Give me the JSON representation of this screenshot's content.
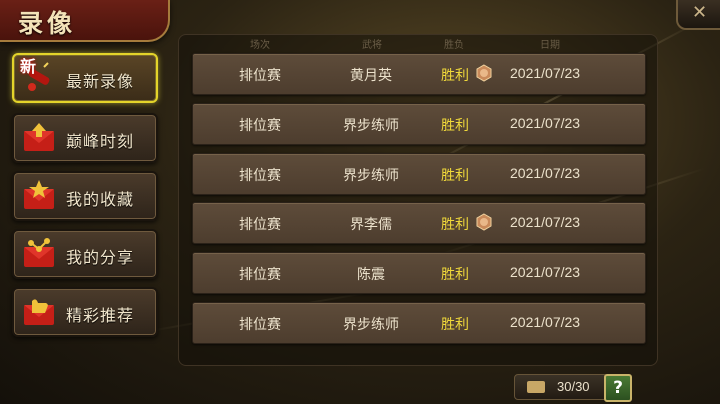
{
  "title": "录像",
  "sidebar": {
    "new_badge": "新",
    "items": [
      {
        "label": "最新录像",
        "icon": "firecracker-icon",
        "active": true
      },
      {
        "label": "巅峰时刻",
        "icon": "red-envelope-up-arrow-icon",
        "active": false
      },
      {
        "label": "我的收藏",
        "icon": "red-envelope-star-icon",
        "active": false
      },
      {
        "label": "我的分享",
        "icon": "red-envelope-share-icon",
        "active": false
      },
      {
        "label": "精彩推荐",
        "icon": "red-envelope-thumbs-up-icon",
        "active": false
      }
    ]
  },
  "table": {
    "headers": [
      "场次",
      "武将",
      "胜负",
      "日期"
    ],
    "rows": [
      {
        "mode": "排位赛",
        "general": "黄月英",
        "result": "胜利",
        "badge": true,
        "date": "2021/07/23"
      },
      {
        "mode": "排位赛",
        "general": "界步练师",
        "result": "胜利",
        "badge": false,
        "date": "2021/07/23"
      },
      {
        "mode": "排位赛",
        "general": "界步练师",
        "result": "胜利",
        "badge": false,
        "date": "2021/07/23"
      },
      {
        "mode": "排位赛",
        "general": "界李儒",
        "result": "胜利",
        "badge": true,
        "date": "2021/07/23"
      },
      {
        "mode": "排位赛",
        "general": "陈震",
        "result": "胜利",
        "badge": false,
        "date": "2021/07/23"
      },
      {
        "mode": "排位赛",
        "general": "界步练师",
        "result": "胜利",
        "badge": false,
        "date": "2021/07/23"
      }
    ]
  },
  "footer": {
    "count": "30/30",
    "help_label": "?"
  },
  "colors": {
    "accent": "#e4d42a",
    "win": "#f0d93a"
  }
}
